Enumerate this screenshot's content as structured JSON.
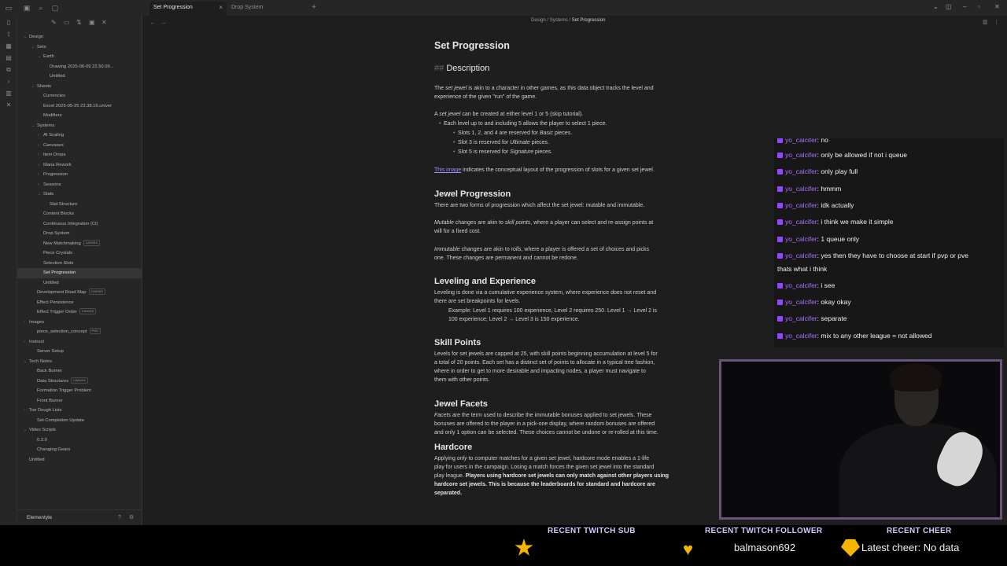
{
  "tabs": [
    {
      "label": "Set Progression",
      "active": true
    },
    {
      "label": "Drop System",
      "active": false
    }
  ],
  "tab_close": "×",
  "new_tab": "+",
  "breadcrumb": [
    "Design",
    "Systems",
    "Set Progression"
  ],
  "breadcrumb_sep": "/",
  "explorer": {
    "items": [
      {
        "label": "Design",
        "depth": 0,
        "chevron": "⌄"
      },
      {
        "label": "Sets",
        "depth": 1,
        "chevron": "⌄"
      },
      {
        "label": "Earth",
        "depth": 2,
        "chevron": "⌄"
      },
      {
        "label": "Drawing 2025-06-09 22.50.09...",
        "depth": 3
      },
      {
        "label": "Untitled",
        "depth": 3
      },
      {
        "label": "Sheets",
        "depth": 1,
        "chevron": "⌄"
      },
      {
        "label": "Currencies",
        "depth": 2
      },
      {
        "label": "Excel 2025-05-25 23.38.16.univer",
        "depth": 2
      },
      {
        "label": "Modifiers",
        "depth": 2
      },
      {
        "label": "Systems",
        "depth": 1,
        "chevron": "⌄"
      },
      {
        "label": "AI Scaling",
        "depth": 2,
        "chevron": "›"
      },
      {
        "label": "Canvases",
        "depth": 2,
        "chevron": "›"
      },
      {
        "label": "Item Drops",
        "depth": 2,
        "chevron": "›"
      },
      {
        "label": "Mana Rework",
        "depth": 2,
        "chevron": "›"
      },
      {
        "label": "Progression",
        "depth": 2,
        "chevron": "›"
      },
      {
        "label": "Seasons",
        "depth": 2,
        "chevron": "›"
      },
      {
        "label": "Stats",
        "depth": 2,
        "chevron": "⌄"
      },
      {
        "label": "Stat Structure",
        "depth": 3
      },
      {
        "label": "Content Blocks",
        "depth": 2
      },
      {
        "label": "Continuous Integration (CI)",
        "depth": 2
      },
      {
        "label": "Drop System",
        "depth": 2
      },
      {
        "label": "New Matchmaking",
        "depth": 2,
        "badge": "CANVAS"
      },
      {
        "label": "Piece Crystals",
        "depth": 2
      },
      {
        "label": "Selection Slots",
        "depth": 2
      },
      {
        "label": "Set Progression",
        "depth": 2,
        "active": true
      },
      {
        "label": "Untitled",
        "depth": 2
      },
      {
        "label": "Development Road Map",
        "depth": 1,
        "badge": "CANVAS"
      },
      {
        "label": "Effect Persistence",
        "depth": 1
      },
      {
        "label": "Effect Trigger Order",
        "depth": 1,
        "badge": "CANVAS"
      },
      {
        "label": "Images",
        "depth": 0,
        "chevron": "›"
      },
      {
        "label": "piece_selection_concept",
        "depth": 1,
        "badge": "PNG"
      },
      {
        "label": "Instruct",
        "depth": 0,
        "chevron": "›"
      },
      {
        "label": "Server Setup",
        "depth": 1
      },
      {
        "label": "Tech Notes",
        "depth": 0,
        "chevron": "⌄"
      },
      {
        "label": "Back Burner",
        "depth": 1
      },
      {
        "label": "Data Structures",
        "depth": 1,
        "badge": "CANVAS"
      },
      {
        "label": "Formation Trigger Problem",
        "depth": 1
      },
      {
        "label": "Front Burner",
        "depth": 1
      },
      {
        "label": "Toe Dough Lists",
        "depth": 0,
        "chevron": "›"
      },
      {
        "label": "Set Completion Update",
        "depth": 1
      },
      {
        "label": "Video Scripts",
        "depth": 0,
        "chevron": "⌄"
      },
      {
        "label": "0.2.0",
        "depth": 1
      },
      {
        "label": "Changing Gears",
        "depth": 1
      },
      {
        "label": "Untitled",
        "depth": 0
      }
    ],
    "vault_name": "Elementyle"
  },
  "doc": {
    "title": "Set Progression",
    "description_heading_hash": "##",
    "description_heading": "Description",
    "p1_a": "The ",
    "p1_em": "set jewel",
    "p1_b": " is akin to a character in other games, as this data object tracks the level and",
    "p1_line2": "experience of the given \"run\" of the game.",
    "p2_a": "A ",
    "p2_em": "set jewel",
    "p2_b": " can be created at either level 1 or 5 (skip tutorial).",
    "b1": "Each level up to and including 5 allows the player to select 1 piece.",
    "b1_1_a": "Slots 1, 2, and 4 are reserved for ",
    "b1_1_em": "Basic",
    "b1_1_b": " pieces.",
    "b1_2_a": "Slot 3 is reserved for ",
    "b1_2_em": "Ultimate",
    "b1_2_b": " pieces.",
    "b1_3_a": "Slot 5 is reserved for ",
    "b1_3_em": "Signature",
    "b1_3_b": " pieces.",
    "link_text": "This image",
    "link_rest": " indicates the conceptual layout of the progression of slots for a given set jewel.",
    "h_jewel_progression": "Jewel Progression",
    "jp1": "There are two forms of progression which affect the set jewel: mutable and immutable.",
    "jp2_em": "Mutable",
    "jp2_a": " changes are akin to ",
    "jp2_em2": "skill points",
    "jp2_b": ", where a player can select and re-assign points at",
    "jp2_line2": "will for a fixed cost.",
    "jp3_em": "Immutable",
    "jp3_a": " changes are akin to ",
    "jp3_em2": "rolls",
    "jp3_b": ", where a player is offered a set of choices and picks",
    "jp3_line2": "one. These changes are permanent and cannot be redone.",
    "h_leveling": "Leveling and Experience",
    "lv1": "Leveling is done via a cumulative experience system, where experience does not reset and",
    "lv1_line2": "there are set breakpoints for levels.",
    "lv2": "Example: Level 1 requires 100 experience, Level 2 requires 250. Level 1 → Level 2 is",
    "lv2_line2": "100 experience; Level 2 → Level 3 is 150 experience.",
    "h_skill": "Skill Points",
    "sk1": "Levels for set jewels are capped at 25, with skill points beginning accumulation at level 5 for",
    "sk2": "a total of 20 points. Each set has a distinct set of points to allocate in a typical tree fashion,",
    "sk3": "where in order to get to more desirable and impacting nodes, a player must navigate to",
    "sk4": "them with other points.",
    "h_facets": "Jewel Facets",
    "jf1_em": "Facets",
    "jf1_a": " are the term used to describe the immutable bonuses applied to set jewels. These",
    "jf2": "bonuses are offered to the player in a pick-one display, where random bonuses are offered",
    "jf3": "and only 1 option can be selected. These choices cannot be undone or re-rolled at this time.",
    "h_hardcore": "Hardcore",
    "hc1_a": "Applying ",
    "hc1_em": "only",
    "hc1_b": " to computer matches for a given set jewel, hardcore mode enables a 1-life",
    "hc2": "play for users in the campaign. Losing a match forces the given set jewel into the standard",
    "hc3_a": "play league. ",
    "hc3_b": "Players using hardcore set jewels can only match against other players using",
    "hc4": "hardcore set jewels. This is because the leaderboards for standard and hardcore are",
    "hc5": "separated."
  },
  "chat": {
    "user": "yo_calcifer",
    "messages": [
      "no",
      "only be allowed if not i queue",
      "only play full",
      "hmmm",
      "idk actually",
      "i think we make it simple",
      "1 queue only",
      "yes then they have to choose at start if pvp or pve",
      "thats what i think",
      "i see",
      "okay okay",
      "separate",
      "mix to any other league = not allowed"
    ]
  },
  "alerts": {
    "sub_heading": "RECENT TWITCH SUB",
    "sub_value": "",
    "follower_heading": "RECENT TWITCH FOLLOWER",
    "follower_value": "balmason692",
    "cheer_heading": "RECENT CHEER",
    "cheer_value": "Latest cheer: No data"
  },
  "colors": {
    "accent_link": "#a88bfa",
    "twitch_user": "#a970ff",
    "alert_gold": "#f4b400"
  }
}
